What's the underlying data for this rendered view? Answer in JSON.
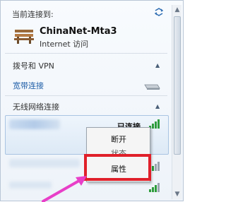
{
  "header": {
    "title": "当前连接到:"
  },
  "current_connection": {
    "name": "ChinaNet-Mta3",
    "status": "Internet 访问"
  },
  "sections": {
    "dialup": {
      "label": "拨号和 VPN",
      "item": "宽带连接"
    },
    "wireless": {
      "label": "无线网络连接"
    }
  },
  "selected_network": {
    "status": "已连接"
  },
  "context_menu": {
    "items": [
      "断开",
      "状态",
      "属性"
    ]
  },
  "colors": {
    "highlight": "#e0202a",
    "arrow": "#e83fc8",
    "link": "#1f5fa8"
  }
}
